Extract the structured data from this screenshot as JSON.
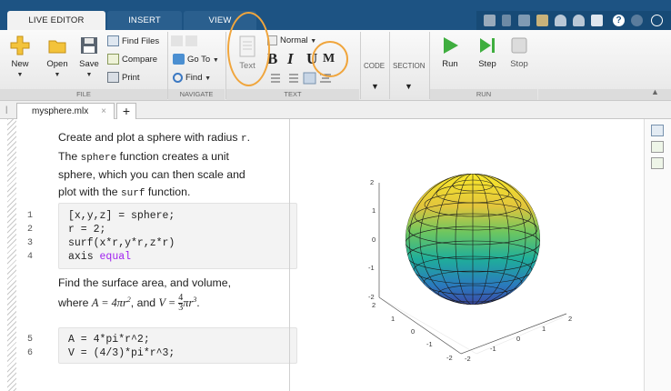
{
  "tabs": [
    {
      "label": "LIVE EDITOR",
      "active": true
    },
    {
      "label": "INSERT",
      "active": false
    },
    {
      "label": "VIEW",
      "active": false
    }
  ],
  "quick_access": {
    "icons": [
      "save-icon",
      "cut-icon",
      "copy-icon",
      "paste-icon",
      "undo-icon",
      "redo-icon",
      "switch-windows-icon",
      "help-icon",
      "minimize-ribbon-icon",
      "options-icon"
    ]
  },
  "ribbon": {
    "file": {
      "group_label": "FILE",
      "new_label": "New",
      "open_label": "Open",
      "save_label": "Save",
      "find_files_label": "Find Files",
      "compare_label": "Compare",
      "print_label": "Print"
    },
    "navigate": {
      "group_label": "NAVIGATE",
      "goto_label": "Go To",
      "find_label": "Find"
    },
    "text": {
      "group_label": "TEXT",
      "text_label": "Text",
      "style_label": "Normal",
      "bold": "B",
      "italic": "I",
      "underline": "U",
      "monospace": "M"
    },
    "code": {
      "group_label": "CODE"
    },
    "section": {
      "group_label": "SECTION"
    },
    "run": {
      "group_label": "RUN",
      "run_label": "Run",
      "step_label": "Step",
      "stop_label": "Stop"
    }
  },
  "editor": {
    "file_tab": "mysphere.mlx",
    "close": "×",
    "add": "+",
    "para1": [
      "Create and plot a sphere with radius ",
      "r",
      ".",
      "The ",
      "sphere",
      " function creates a unit",
      "sphere, which you can then scale and",
      "plot with the ",
      "surf",
      " function."
    ],
    "code1": [
      {
        "n": "1",
        "code": "[x,y,z] = sphere;"
      },
      {
        "n": "2",
        "code": "r = 2;"
      },
      {
        "n": "3",
        "code": "surf(x*r,y*r,z*r)"
      },
      {
        "n": "4",
        "code": "axis ",
        "keyword": "equal"
      }
    ],
    "para2": {
      "line1": "Find the surface area, and volume,",
      "where": "where ",
      "formula_a": "A = 4πr",
      "and": ", and ",
      "formula_v": "V = ",
      "frac_num": "4",
      "frac_den": "3",
      "formula_v_tail": "πr",
      "exp": "2",
      "exp3": "3",
      "end": "."
    },
    "code2": [
      {
        "n": "5",
        "code": "A = 4*pi*r^2;"
      },
      {
        "n": "6",
        "code": "V = (4/3)*pi*r^3;"
      }
    ]
  },
  "plot": {
    "z_ticks": [
      "2",
      "1",
      "0",
      "-1",
      "-2"
    ],
    "y_ticks": [
      "2",
      "1",
      "0",
      "-1",
      "-2"
    ],
    "x_ticks": [
      "2",
      "1",
      "0",
      "-1",
      "-2"
    ]
  },
  "colors": {
    "tabbar": "#1d5383",
    "highlight_circle": "#f0a53c",
    "keyword": "#a020f0",
    "run_green": "#3fae3f"
  }
}
